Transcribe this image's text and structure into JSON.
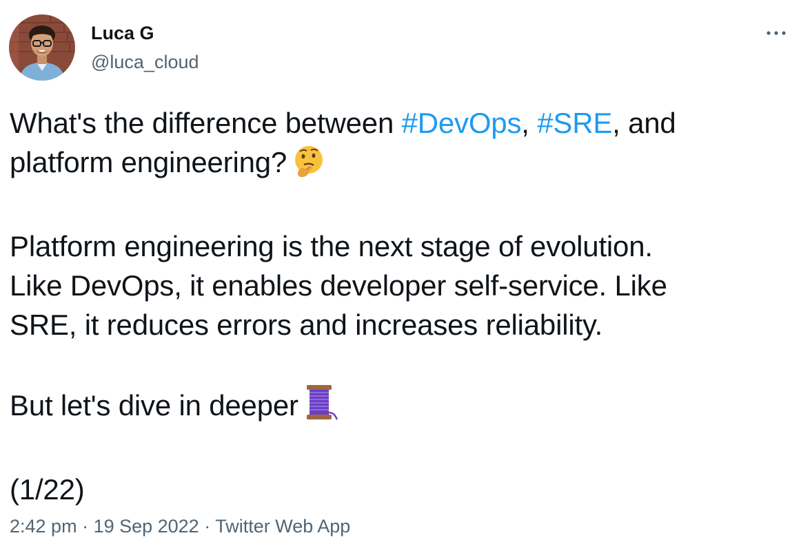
{
  "author": {
    "display_name": "Luca G",
    "handle": "@luca_cloud"
  },
  "more_icon": "more-horizontal-icon",
  "tweet": {
    "line1_before": "What's the difference between ",
    "hashtag1": "#DevOps",
    "line1_sep": ", ",
    "hashtag2": "#SRE",
    "line1_after": ", and",
    "line2": "platform engineering?",
    "emoji1": "thinking-face-emoji",
    "para2_l1": "Platform engineering is the next stage of evolution.",
    "para2_l2": "Like DevOps, it enables developer self-service. Like",
    "para2_l3": "SRE, it reduces errors and increases reliability.",
    "para3": "But let's dive in deeper",
    "emoji2": "thread-spool-emoji",
    "counter": "(1/22)"
  },
  "meta": {
    "time": "2:42 pm",
    "sep1": " · ",
    "date": "19 Sep 2022",
    "sep2": " · ",
    "source": "Twitter Web App"
  },
  "colors": {
    "text": "#0f1419",
    "secondary": "#536471",
    "link": "#1d9bf0"
  }
}
